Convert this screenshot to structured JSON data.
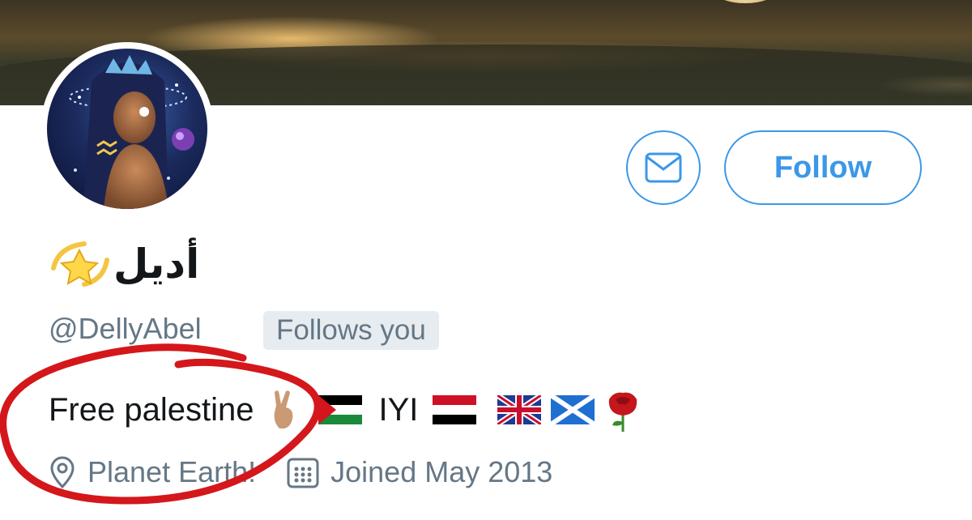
{
  "profile": {
    "display_name": "أديل",
    "name_emoji": "dizzy-star-emoji",
    "handle": "@DellyAbel",
    "follows_you": "Follows you",
    "bio_text": "Free palestine",
    "bio_middle": "IYI",
    "location": "Planet Earth!",
    "joined": "Joined May 2013"
  },
  "actions": {
    "message_icon": "envelope-icon",
    "follow_label": "Follow"
  },
  "colors": {
    "accent": "#3b98e8",
    "secondary_text": "#657786",
    "badge_bg": "#e6ecf0",
    "annotation": "#d4171b"
  }
}
